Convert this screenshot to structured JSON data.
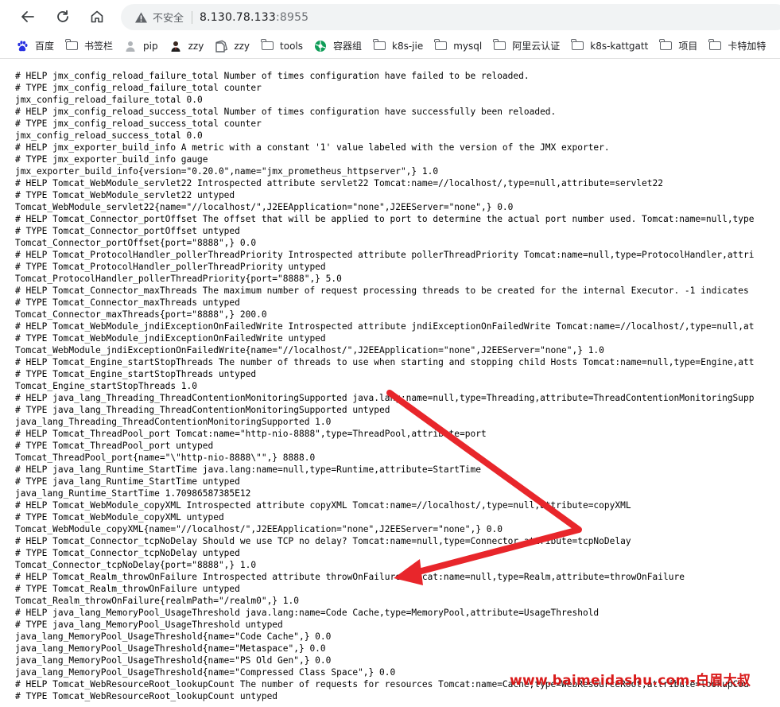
{
  "browser": {
    "nav": {
      "back_icon": "back-arrow-icon",
      "reload_icon": "reload-icon",
      "home_icon": "home-icon"
    },
    "address_bar": {
      "security_icon": "warning-triangle-icon",
      "security_label": "不安全",
      "host": "8.130.78.133",
      "port": ":8955"
    },
    "bookmarks": [
      {
        "label": "百度",
        "icon": "baidu-paw-icon"
      },
      {
        "label": "书签栏",
        "icon": "folder-icon"
      },
      {
        "label": "pip",
        "icon": "person-icon"
      },
      {
        "label": "zzy",
        "icon": "avatar-icon"
      },
      {
        "label": "zzy",
        "icon": "bookmark-page-icon"
      },
      {
        "label": "tools",
        "icon": "folder-icon"
      },
      {
        "label": "容器组",
        "icon": "kubernetes-icon"
      },
      {
        "label": "k8s-jie",
        "icon": "folder-icon"
      },
      {
        "label": "mysql",
        "icon": "folder-icon"
      },
      {
        "label": "阿里云认证",
        "icon": "folder-icon"
      },
      {
        "label": "k8s-kattgatt",
        "icon": "folder-icon"
      },
      {
        "label": "项目",
        "icon": "folder-icon"
      },
      {
        "label": "卡特加特",
        "icon": "folder-icon"
      }
    ]
  },
  "page": {
    "lines": [
      "# HELP jmx_config_reload_failure_total Number of times configuration have failed to be reloaded.",
      "# TYPE jmx_config_reload_failure_total counter",
      "jmx_config_reload_failure_total 0.0",
      "# HELP jmx_config_reload_success_total Number of times configuration have successfully been reloaded.",
      "# TYPE jmx_config_reload_success_total counter",
      "jmx_config_reload_success_total 0.0",
      "# HELP jmx_exporter_build_info A metric with a constant '1' value labeled with the version of the JMX exporter.",
      "# TYPE jmx_exporter_build_info gauge",
      "jmx_exporter_build_info{version=\"0.20.0\",name=\"jmx_prometheus_httpserver\",} 1.0",
      "# HELP Tomcat_WebModule_servlet22 Introspected attribute servlet22 Tomcat:name=//localhost/,type=null,attribute=servlet22",
      "# TYPE Tomcat_WebModule_servlet22 untyped",
      "Tomcat_WebModule_servlet22{name=\"//localhost/\",J2EEApplication=\"none\",J2EEServer=\"none\",} 0.0",
      "# HELP Tomcat_Connector_portOffset The offset that will be applied to port to determine the actual port number used. Tomcat:name=null,type",
      "# TYPE Tomcat_Connector_portOffset untyped",
      "Tomcat_Connector_portOffset{port=\"8888\",} 0.0",
      "# HELP Tomcat_ProtocolHandler_pollerThreadPriority Introspected attribute pollerThreadPriority Tomcat:name=null,type=ProtocolHandler,attri",
      "# TYPE Tomcat_ProtocolHandler_pollerThreadPriority untyped",
      "Tomcat_ProtocolHandler_pollerThreadPriority{port=\"8888\",} 5.0",
      "# HELP Tomcat_Connector_maxThreads The maximum number of request processing threads to be created for the internal Executor. -1 indicates",
      "# TYPE Tomcat_Connector_maxThreads untyped",
      "Tomcat_Connector_maxThreads{port=\"8888\",} 200.0",
      "# HELP Tomcat_WebModule_jndiExceptionOnFailedWrite Introspected attribute jndiExceptionOnFailedWrite Tomcat:name=//localhost/,type=null,at",
      "# TYPE Tomcat_WebModule_jndiExceptionOnFailedWrite untyped",
      "Tomcat_WebModule_jndiExceptionOnFailedWrite{name=\"//localhost/\",J2EEApplication=\"none\",J2EEServer=\"none\",} 1.0",
      "# HELP Tomcat_Engine_startStopThreads The number of threads to use when starting and stopping child Hosts Tomcat:name=null,type=Engine,att",
      "# TYPE Tomcat_Engine_startStopThreads untyped",
      "Tomcat_Engine_startStopThreads 1.0",
      "# HELP java_lang_Threading_ThreadContentionMonitoringSupported java.lang:name=null,type=Threading,attribute=ThreadContentionMonitoringSupp",
      "# TYPE java_lang_Threading_ThreadContentionMonitoringSupported untyped",
      "java_lang_Threading_ThreadContentionMonitoringSupported 1.0",
      "# HELP Tomcat_ThreadPool_port Tomcat:name=\"http-nio-8888\",type=ThreadPool,attribute=port",
      "# TYPE Tomcat_ThreadPool_port untyped",
      "Tomcat_ThreadPool_port{name=\"\\\"http-nio-8888\\\"\",} 8888.0",
      "# HELP java_lang_Runtime_StartTime java.lang:name=null,type=Runtime,attribute=StartTime",
      "# TYPE java_lang_Runtime_StartTime untyped",
      "java_lang_Runtime_StartTime 1.70986587385E12",
      "# HELP Tomcat_WebModule_copyXML Introspected attribute copyXML Tomcat:name=//localhost/,type=null,attribute=copyXML",
      "# TYPE Tomcat_WebModule_copyXML untyped",
      "Tomcat_WebModule_copyXML{name=\"//localhost/\",J2EEApplication=\"none\",J2EEServer=\"none\",} 0.0",
      "# HELP Tomcat_Connector_tcpNoDelay Should we use TCP no delay? Tomcat:name=null,type=Connector,attribute=tcpNoDelay",
      "# TYPE Tomcat_Connector_tcpNoDelay untyped",
      "Tomcat_Connector_tcpNoDelay{port=\"8888\",} 1.0",
      "# HELP Tomcat_Realm_throwOnFailure Introspected attribute throwOnFailure Tomcat:name=null,type=Realm,attribute=throwOnFailure",
      "# TYPE Tomcat_Realm_throwOnFailure untyped",
      "Tomcat_Realm_throwOnFailure{realmPath=\"/realm0\",} 1.0",
      "# HELP java_lang_MemoryPool_UsageThreshold java.lang:name=Code Cache,type=MemoryPool,attribute=UsageThreshold",
      "# TYPE java_lang_MemoryPool_UsageThreshold untyped",
      "java_lang_MemoryPool_UsageThreshold{name=\"Code Cache\",} 0.0",
      "java_lang_MemoryPool_UsageThreshold{name=\"Metaspace\",} 0.0",
      "java_lang_MemoryPool_UsageThreshold{name=\"PS Old Gen\",} 0.0",
      "java_lang_MemoryPool_UsageThreshold{name=\"Compressed Class Space\",} 0.0",
      "# HELP Tomcat_WebResourceRoot_lookupCount The number of requests for resources Tomcat:name=Cache,type=WebResourceRoot,attribute=lookupCou",
      "# TYPE Tomcat_WebResourceRoot_lookupCount untyped"
    ]
  },
  "annotation": {
    "arrow_color": "#e8262b",
    "watermark": "www.baimeidashu.com-白眉大叔"
  }
}
